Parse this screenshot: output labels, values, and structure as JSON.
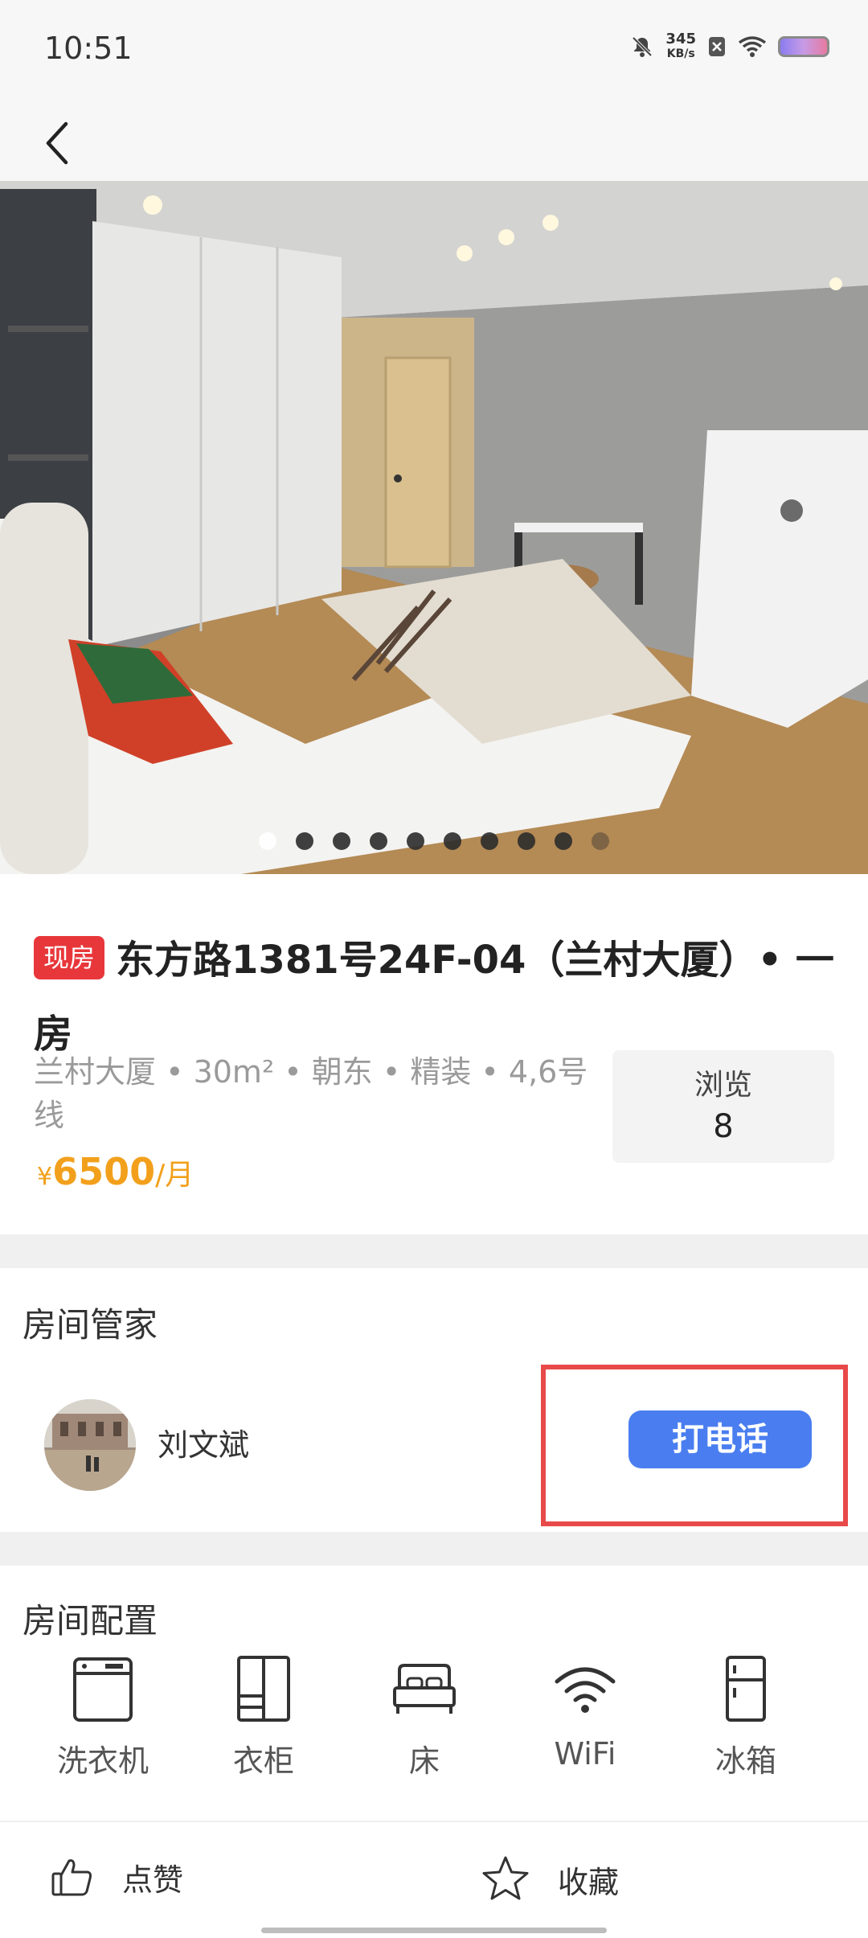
{
  "status_bar": {
    "time": "10:51",
    "speed_value": "345",
    "speed_unit": "KB/s"
  },
  "listing": {
    "badge": "现房",
    "title": "东方路1381号24F-04（兰村大厦）• 一房",
    "meta": "兰村大厦 • 30m² • 朝东 • 精装 • 4,6号线",
    "views_label": "浏览",
    "views_count": "8",
    "price_currency": "¥",
    "price_value": "6500",
    "price_unit": "/月",
    "photo_count": 10,
    "photo_index": 1
  },
  "steward": {
    "section_title": "房间管家",
    "name": "刘文斌",
    "call_label": "打电话"
  },
  "amenities": {
    "section_title": "房间配置",
    "items": [
      {
        "label": "洗衣机",
        "icon": "washing-machine-icon"
      },
      {
        "label": "衣柜",
        "icon": "wardrobe-icon"
      },
      {
        "label": "床",
        "icon": "bed-icon"
      },
      {
        "label": "WiFi",
        "icon": "wifi-icon"
      },
      {
        "label": "冰箱",
        "icon": "fridge-icon"
      }
    ]
  },
  "bottom_bar": {
    "like_label": "点赞",
    "favorite_label": "收藏"
  }
}
